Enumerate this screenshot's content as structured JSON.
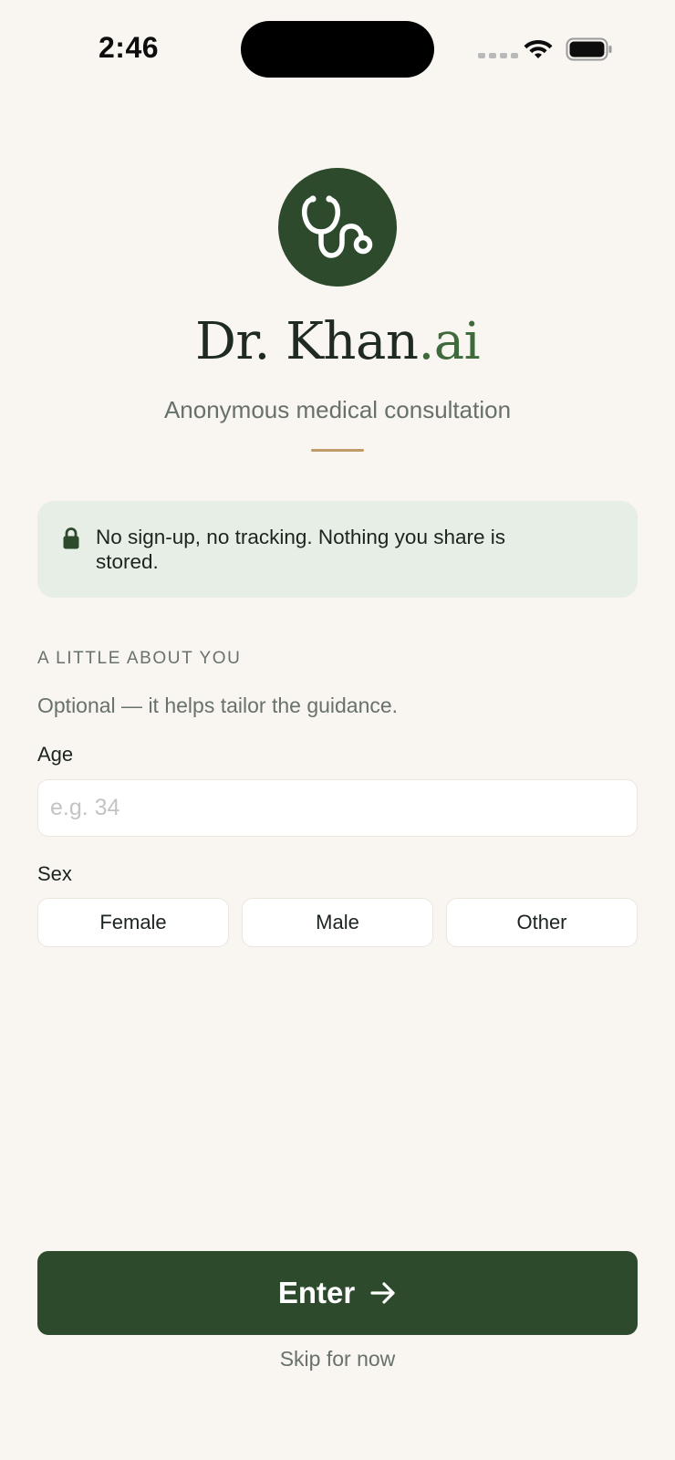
{
  "status_bar": {
    "time": "2:46"
  },
  "brand": {
    "name_main": "Dr. Khan",
    "name_suffix": ".ai",
    "subtitle": "Anonymous medical consultation"
  },
  "privacy_banner": {
    "text": "No sign-up, no tracking. Nothing you share is stored."
  },
  "profile_section": {
    "heading": "A LITTLE ABOUT YOU",
    "description": "Optional — it helps tailor the guidance.",
    "age_label": "Age",
    "age_placeholder": "e.g. 34",
    "age_value": "",
    "sex_label": "Sex",
    "sex_options": [
      "Female",
      "Male",
      "Other"
    ]
  },
  "actions": {
    "enter_label": "Enter",
    "enter_icon": "arrow-right-icon",
    "skip_label": "Skip for now"
  },
  "colors": {
    "background": "#f9f6f1",
    "brand_green": "#2e4a2d",
    "accent_green": "#3f6a3c",
    "divider_tan": "#c29a68",
    "banner_bg": "#e6eee6"
  }
}
